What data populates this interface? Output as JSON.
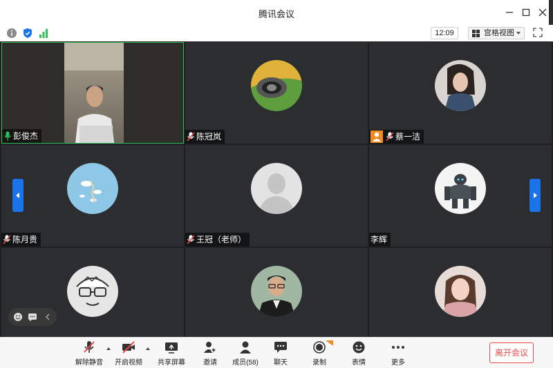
{
  "window": {
    "title": "腾讯会议"
  },
  "status": {
    "clock": "12:09",
    "view_label": "宫格视图",
    "icons": [
      "info-icon",
      "shield-icon",
      "signal-icon",
      "fullscreen-icon"
    ]
  },
  "participants": [
    {
      "name": "彭俊杰",
      "mic": "on",
      "video": true
    },
    {
      "name": "陈冠岚",
      "mic": "muted"
    },
    {
      "name": "蔡一洁",
      "mic": "muted",
      "host": true
    },
    {
      "name": "陈月贵",
      "mic": "muted"
    },
    {
      "name": "王冠（老师）",
      "mic": "muted"
    },
    {
      "name": "李辉",
      "mic": "none"
    },
    {
      "name": "",
      "mic": "none"
    },
    {
      "name": "",
      "mic": "none"
    },
    {
      "name": "",
      "mic": "none"
    }
  ],
  "toolbar": {
    "unmute": "解除静音",
    "start_video": "开启视频",
    "share_screen": "共享屏幕",
    "invite": "邀请",
    "members": "成员(58)",
    "chat": "聊天",
    "record": "录制",
    "reactions": "表情",
    "more": "更多",
    "leave": "离开会议"
  },
  "colors": {
    "accent": "#1a73e8",
    "active_speaker": "#2fc25b",
    "leave": "#e94b4b",
    "host_badge": "#f08c28"
  }
}
